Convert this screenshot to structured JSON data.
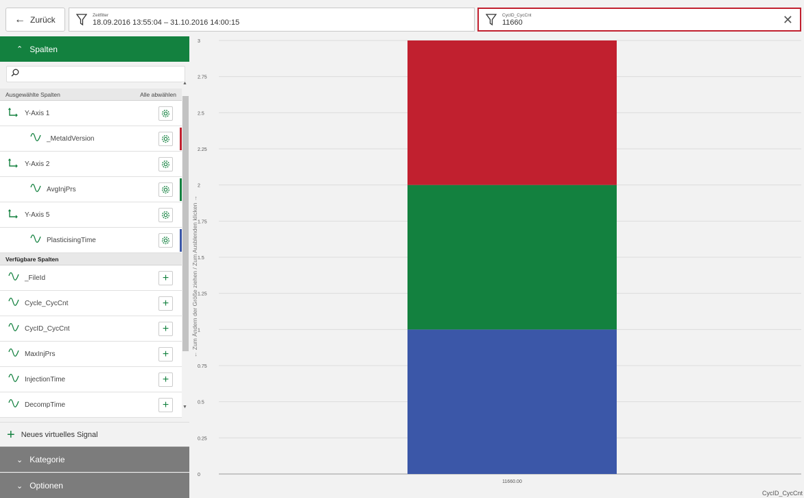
{
  "topbar": {
    "back_label": "Zurück",
    "time_filter_label": "Zeitfilter",
    "time_filter_value": "18.09.2016 13:55:04 – 31.10.2016 14:00:15",
    "cycle_filter_label": "CycID_CycCnt",
    "cycle_filter_value": "11660"
  },
  "sidebar": {
    "columns_header": "Spalten",
    "search_placeholder": "",
    "selected_header": "Ausgewählte Spalten",
    "deselect_all": "Alle abwählen",
    "selected": [
      {
        "type": "axis",
        "label": "Y-Axis 1"
      },
      {
        "type": "signal",
        "label": "_MetaIdVersion",
        "color": "#c1202f"
      },
      {
        "type": "axis",
        "label": "Y-Axis 2"
      },
      {
        "type": "signal",
        "label": "AvgInjPrs",
        "color": "#13813f"
      },
      {
        "type": "axis",
        "label": "Y-Axis 5"
      },
      {
        "type": "signal",
        "label": "PlasticisingTime",
        "color": "#3b57a8"
      }
    ],
    "available_header": "Verfügbare Spalten",
    "available": [
      "_FileId",
      "Cycle_CycCnt",
      "CycID_CycCnt",
      "MaxInjPrs",
      "InjectionTime",
      "DecompTime"
    ],
    "new_signal": "Neues virtuelles Signal",
    "category_header": "Kategorie",
    "options_header": "Optionen",
    "splitter_hint": "Zum Ändern der Größe ziehen / Zum Ausblenden klicken"
  },
  "chart_data": {
    "type": "bar",
    "stacked": true,
    "categories": [
      "11660.00"
    ],
    "series": [
      {
        "values": [
          1
        ],
        "color": "#3b57a8"
      },
      {
        "values": [
          1
        ],
        "color": "#13813f"
      },
      {
        "values": [
          1
        ],
        "color": "#c1202f"
      }
    ],
    "xlabel": "CycID_CycCnt",
    "ylim": [
      0,
      3
    ],
    "yticks": [
      "0",
      "0.25",
      "0.5",
      "0.75",
      "1",
      "1.25",
      "1.5",
      "1.75",
      "2",
      "2.25",
      "2.5",
      "2.75",
      "3"
    ],
    "grid": true
  }
}
